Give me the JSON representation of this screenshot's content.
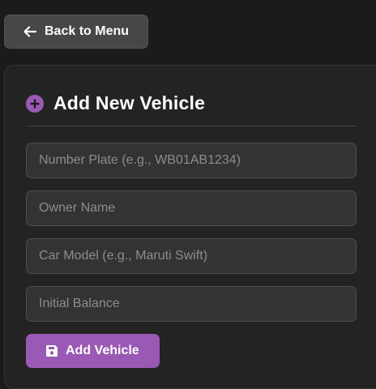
{
  "nav": {
    "back_label": "Back to Menu",
    "back_icon": "arrow-left-icon"
  },
  "form": {
    "title": "Add New Vehicle",
    "title_icon": "plus-circle-icon",
    "fields": [
      {
        "placeholder": "Number Plate (e.g., WB01AB1234)",
        "value": ""
      },
      {
        "placeholder": "Owner Name",
        "value": ""
      },
      {
        "placeholder": "Car Model (e.g., Maruti Swift)",
        "value": ""
      },
      {
        "placeholder": "Initial Balance",
        "value": ""
      }
    ],
    "submit_label": "Add Vehicle",
    "submit_icon": "save-icon"
  },
  "colors": {
    "accent": "#9b59b6",
    "background": "#1b1b1b",
    "card": "#232323",
    "input": "#333333"
  }
}
